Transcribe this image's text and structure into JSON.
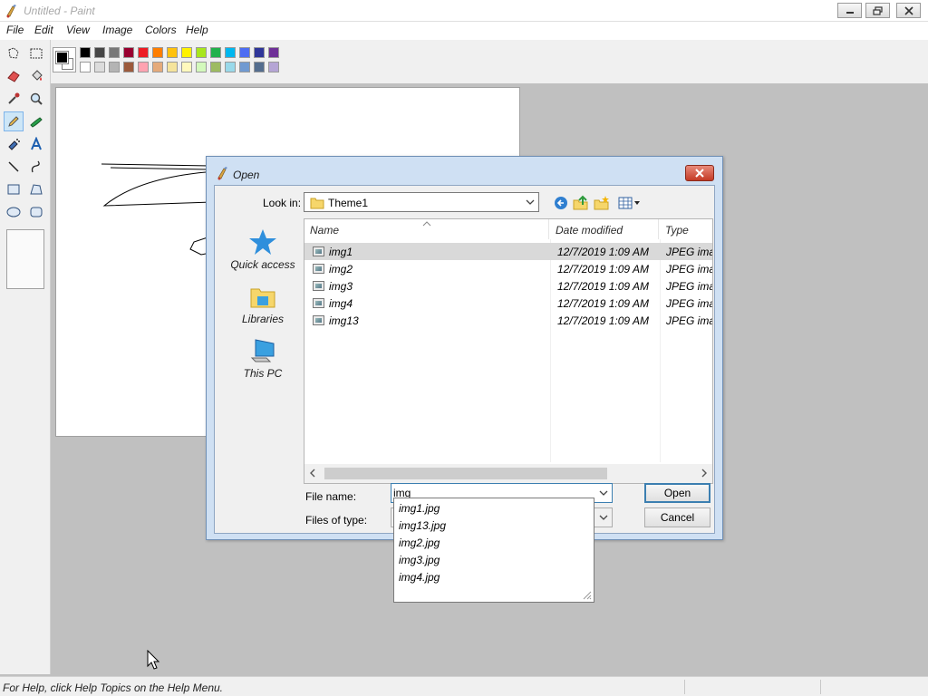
{
  "window": {
    "title": "Untitled - Paint"
  },
  "menu": [
    {
      "label": "File"
    },
    {
      "label": "Edit"
    },
    {
      "label": "View"
    },
    {
      "label": "Image"
    },
    {
      "label": "Colors"
    },
    {
      "label": "Help"
    }
  ],
  "tools": [
    {
      "name": "free-form-select-icon"
    },
    {
      "name": "rectangle-select-icon"
    },
    {
      "name": "eraser-icon"
    },
    {
      "name": "fill-bucket-icon"
    },
    {
      "name": "color-picker-icon"
    },
    {
      "name": "magnifier-icon"
    },
    {
      "name": "pencil-icon",
      "selected": true
    },
    {
      "name": "brush-icon"
    },
    {
      "name": "airbrush-icon"
    },
    {
      "name": "text-icon"
    },
    {
      "name": "line-icon"
    },
    {
      "name": "curve-icon"
    },
    {
      "name": "rectangle-icon"
    },
    {
      "name": "polygon-icon"
    },
    {
      "name": "ellipse-icon"
    },
    {
      "name": "rounded-rectangle-icon"
    }
  ],
  "palette": {
    "foreground": "#000000",
    "background": "#ffffff",
    "row1": [
      "#000000",
      "#464646",
      "#787878",
      "#990030",
      "#ed1c24",
      "#ff7e00",
      "#ffc20e",
      "#fff200",
      "#a8e61d",
      "#22b14c",
      "#00b7ef",
      "#4d6df3",
      "#2f3699",
      "#6f3198"
    ],
    "row2": [
      "#ffffff",
      "#dcdcdc",
      "#b4b4b4",
      "#9c5a3c",
      "#ffa3b1",
      "#e5aa7a",
      "#f5e49c",
      "#fff9bd",
      "#d3f9bc",
      "#9dbb61",
      "#99d9ea",
      "#709ad1",
      "#546d8e",
      "#b5a5d5"
    ]
  },
  "status": {
    "help_text": "For Help, click Help Topics on the Help Menu."
  },
  "dialog": {
    "title": "Open",
    "look_in_label": "Look in:",
    "look_in_value": "Theme1",
    "places": [
      {
        "label": "Quick access",
        "icon": "star-icon"
      },
      {
        "label": "Libraries",
        "icon": "libraries-icon"
      },
      {
        "label": "This PC",
        "icon": "computer-icon"
      }
    ],
    "columns": [
      "Name",
      "Date modified",
      "Type"
    ],
    "files": [
      {
        "name": "img1",
        "date": "12/7/2019 1:09 AM",
        "type": "JPEG image"
      },
      {
        "name": "img2",
        "date": "12/7/2019 1:09 AM",
        "type": "JPEG image"
      },
      {
        "name": "img3",
        "date": "12/7/2019 1:09 AM",
        "type": "JPEG image"
      },
      {
        "name": "img4",
        "date": "12/7/2019 1:09 AM",
        "type": "JPEG image"
      },
      {
        "name": "img13",
        "date": "12/7/2019 1:09 AM",
        "type": "JPEG image"
      }
    ],
    "file_name_label": "File name:",
    "file_name_value": "img",
    "files_of_type_label": "Files of type:",
    "open_label": "Open",
    "cancel_label": "Cancel",
    "autocomplete": [
      "img1.jpg",
      "img13.jpg",
      "img2.jpg",
      "img3.jpg",
      "img4.jpg"
    ]
  }
}
